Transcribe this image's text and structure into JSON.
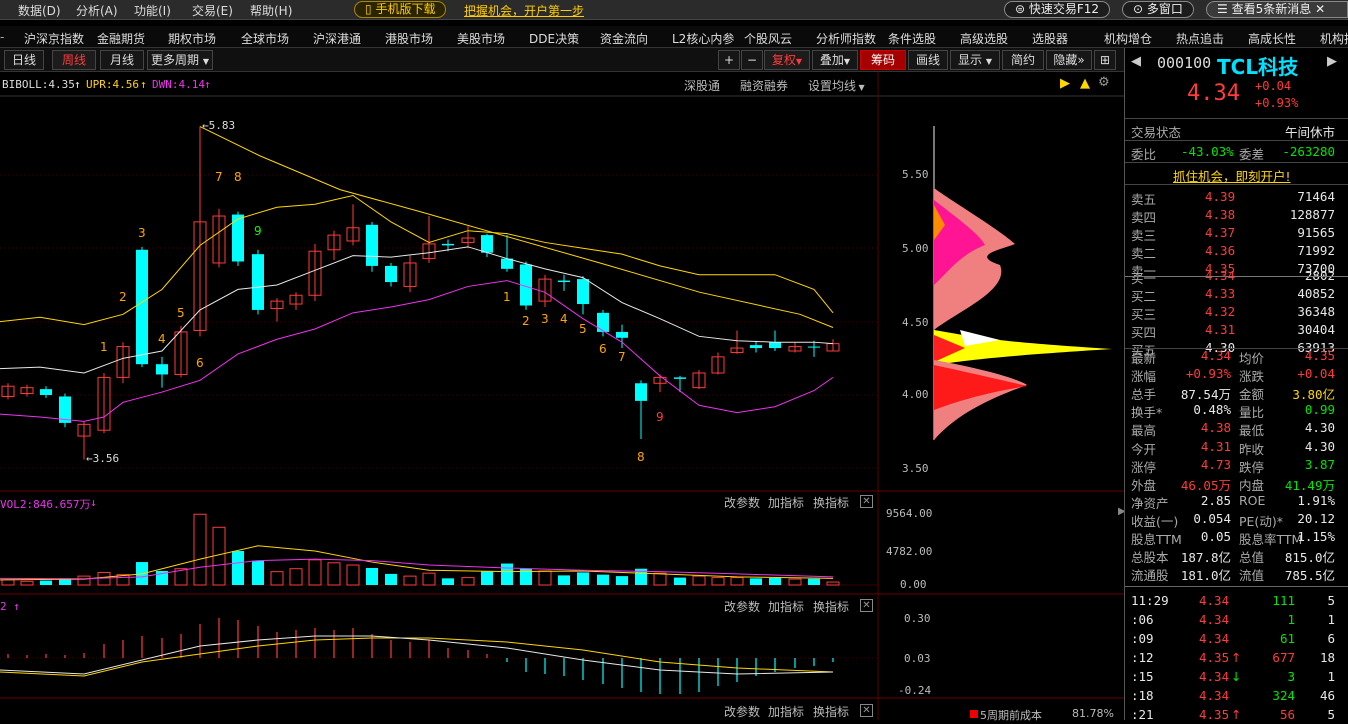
{
  "menu": {
    "items": [
      "数据(D)",
      "分析(A)",
      "功能(I)",
      "交易(E)",
      "帮助(H)"
    ],
    "mobile": "手机版下载",
    "promo": "把握机会，开户第一步",
    "quick_trade": "快速交易F12",
    "multi_window": "多窗口",
    "news": "查看5条新消息"
  },
  "nav": {
    "items": [
      "沪深京指数",
      "金融期货",
      "期权市场",
      "全球市场",
      "沪深港通",
      "港股市场",
      "美股市场",
      "DDE决策",
      "资金流向",
      "L2核心内参",
      "个股风云",
      "分析师指数",
      "条件选股",
      "高级选股",
      "选股器",
      "机构增仓",
      "热点追击",
      "高成长性",
      "机构持"
    ]
  },
  "period": {
    "day": "日线",
    "week": "周线",
    "month": "月线",
    "more": "更多周期",
    "plus": "+",
    "minus": "−",
    "fuquan": "复权",
    "overlay": "叠加",
    "chips": "筹码",
    "draw": "画线",
    "display": "显示",
    "simplify": "简约",
    "hide": "隐藏"
  },
  "main": {
    "boll": "BIBOLL:4.35",
    "upr": "UPR:4.56",
    "dwn": "DWN:4.14",
    "links": [
      "深股通",
      "融资融券",
      "设置均线"
    ],
    "axis": [
      "5.50",
      "5.00",
      "4.50",
      "4.00",
      "3.50"
    ],
    "high_label": "5.83",
    "low_label": "3.56",
    "counts": [
      "1",
      "2",
      "3",
      "4",
      "5",
      "6",
      "7",
      "8",
      "9",
      "1",
      "2",
      "3",
      "4",
      "5",
      "6",
      "7",
      "8",
      "9"
    ]
  },
  "vol": {
    "label": "VOL2:846.657万",
    "axis": [
      "9564.00",
      "4782.00",
      "0.00"
    ],
    "ctrl": [
      "改参数",
      "加指标",
      "换指标"
    ]
  },
  "macd": {
    "label": "2",
    "axis": [
      "0.30",
      "0.03",
      "-0.24"
    ],
    "ctrl": [
      "改参数",
      "加指标",
      "换指标"
    ]
  },
  "bottom": {
    "ctrl": [
      "改参数",
      "加指标",
      "换指标"
    ],
    "chip_text": "5周期前成本",
    "chip_pct": "81.78%"
  },
  "stock": {
    "code": "000100",
    "name": "TCL科技",
    "price": "4.34",
    "change": "+0.04",
    "pct": "+0.93%",
    "status_label": "交易状态",
    "status": "午间休市",
    "weibi_label": "委比",
    "weibi": "-43.03%",
    "weicha_label": "委差",
    "weicha": "-263280",
    "ad": "抓住机会，即刻开户!",
    "asks": [
      {
        "l": "卖五",
        "p": "4.39",
        "v": "71464"
      },
      {
        "l": "卖四",
        "p": "4.38",
        "v": "128877"
      },
      {
        "l": "卖三",
        "p": "4.37",
        "v": "91565"
      },
      {
        "l": "卖二",
        "p": "4.36",
        "v": "71992"
      },
      {
        "l": "卖一",
        "p": "4.35",
        "v": "73700"
      }
    ],
    "bids": [
      {
        "l": "买一",
        "p": "4.34",
        "v": "2802"
      },
      {
        "l": "买二",
        "p": "4.33",
        "v": "40852"
      },
      {
        "l": "买三",
        "p": "4.32",
        "v": "36348"
      },
      {
        "l": "买四",
        "p": "4.31",
        "v": "30404"
      },
      {
        "l": "买五",
        "p": "4.30",
        "v": "63913"
      }
    ],
    "stats": [
      {
        "a": "最新",
        "av": "4.34",
        "ac": "red",
        "b": "均价",
        "bv": "4.35",
        "bc": "red"
      },
      {
        "a": "涨幅",
        "av": "+0.93%",
        "ac": "red",
        "b": "涨跌",
        "bv": "+0.04",
        "bc": "red"
      },
      {
        "a": "总手",
        "av": "87.54万",
        "ac": "wht",
        "b": "金额",
        "bv": "3.80亿",
        "bc": "yel"
      },
      {
        "a": "换手*",
        "av": "0.48%",
        "ac": "wht",
        "b": "量比",
        "bv": "0.99",
        "bc": "grn"
      },
      {
        "a": "最高",
        "av": "4.38",
        "ac": "red",
        "b": "最低",
        "bv": "4.30",
        "bc": "wht"
      },
      {
        "a": "今开",
        "av": "4.31",
        "ac": "red",
        "b": "昨收",
        "bv": "4.30",
        "bc": "wht"
      },
      {
        "a": "涨停",
        "av": "4.73",
        "ac": "red",
        "b": "跌停",
        "bv": "3.87",
        "bc": "grn"
      },
      {
        "a": "外盘",
        "av": "46.05万",
        "ac": "red",
        "b": "内盘",
        "bv": "41.49万",
        "bc": "grn"
      },
      {
        "a": "净资产",
        "av": "2.85",
        "ac": "wht",
        "b": "ROE",
        "bv": "1.91%",
        "bc": "wht"
      },
      {
        "a": "收益(一)",
        "av": "0.054",
        "ac": "wht",
        "b": "PE(动)*",
        "bv": "20.12",
        "bc": "wht"
      },
      {
        "a": "股息TTM",
        "av": "0.05",
        "ac": "wht",
        "b": "股息率TTM",
        "bv": "1.15%",
        "bc": "wht"
      },
      {
        "a": "总股本",
        "av": "187.8亿",
        "ac": "wht",
        "b": "总值",
        "bv": "815.0亿",
        "bc": "wht"
      },
      {
        "a": "流通股",
        "av": "181.0亿",
        "ac": "wht",
        "b": "流值",
        "bv": "785.5亿",
        "bc": "wht"
      }
    ],
    "ticks": [
      {
        "t": "11:29",
        "p": "4.34",
        "arrow": "",
        "v": "111",
        "n": "5",
        "vc": "grn"
      },
      {
        "t": ":06",
        "p": "4.34",
        "arrow": "",
        "v": "1",
        "n": "1",
        "vc": "grn"
      },
      {
        "t": ":09",
        "p": "4.34",
        "arrow": "",
        "v": "61",
        "n": "6",
        "vc": "grn"
      },
      {
        "t": ":12",
        "p": "4.35",
        "arrow": "↑",
        "v": "677",
        "n": "18",
        "vc": "red"
      },
      {
        "t": ":15",
        "p": "4.34",
        "arrow": "↓",
        "v": "3",
        "n": "1",
        "vc": "grn"
      },
      {
        "t": ":18",
        "p": "4.34",
        "arrow": "",
        "v": "324",
        "n": "46",
        "vc": "grn"
      },
      {
        "t": ":21",
        "p": "4.35",
        "arrow": "↑",
        "v": "56",
        "n": "5",
        "vc": "red"
      }
    ]
  }
}
